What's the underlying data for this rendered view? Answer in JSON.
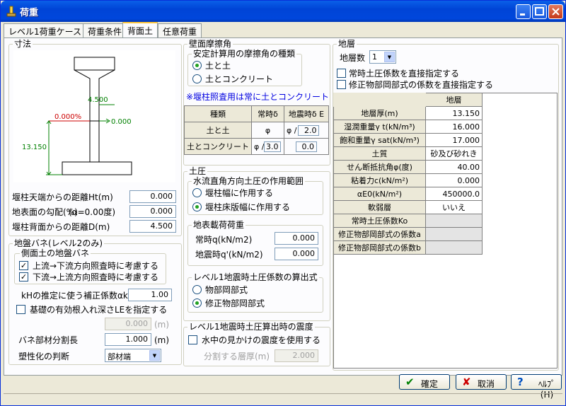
{
  "window": {
    "title": "荷重"
  },
  "tabs": [
    "レベル1荷重ケース",
    "荷重条件",
    "背面土",
    "任意荷重"
  ],
  "dimensions": {
    "group_label": "寸法",
    "diagram": {
      "width_label": "4.500",
      "slope_label": "0.000%",
      "right_label": "0.000",
      "height_label": "13.150"
    },
    "ht_label": "堰柱天端からの距離Ht(m)",
    "ht_value": "0.000",
    "slope_label": "地表面の勾配(%)",
    "alpha_label": "(α=0.00度)",
    "slope_value": "0.000",
    "d_label": "堰柱背面からの距離D(m)",
    "d_value": "4.500"
  },
  "spring": {
    "group_label": "地盤バネ(レベル2のみ)",
    "side_label": "側面土の地盤バネ",
    "cb1": "上流→下流方向照査時に考慮する",
    "cb2": "下流→上流方向照査時に考慮する",
    "kh_label": "kHの推定に使う補正係数αk",
    "kh_value": "1.00",
    "cb3": "基礎の有効根入れ深さLEを指定する",
    "le_value": "0.000",
    "le_unit": "(m)",
    "split_label": "バネ部材分割長",
    "split_value": "1.000",
    "split_unit": "(m)",
    "plastic_label": "塑性化の判断",
    "plastic_value": "部材端"
  },
  "friction": {
    "group_label": "壁面摩擦角",
    "sub_label": "安定計算用の摩擦角の種類",
    "r1": "土と土",
    "r2": "土とコンクリート",
    "note": "※堰柱照査用は常に土とコンクリート",
    "hdr": [
      "種類",
      "常時δ",
      "地震時δ E"
    ],
    "row1": {
      "name": "土と土",
      "normal": "φ",
      "quake_prefix": "φ /",
      "quake_value": "2.0"
    },
    "row2": {
      "name": "土とコンクリート",
      "normal_prefix": "φ /",
      "normal_value": "3.0",
      "quake_value": "0.0"
    }
  },
  "pressure": {
    "group_label": "土圧",
    "range_label": "水流直角方向土圧の作用範囲",
    "r1": "堰柱幅に作用する",
    "r2": "堰柱床版幅に作用する",
    "surcharge_label": "地表載荷荷重",
    "q_label": "常時q(kN/m2)",
    "q_value": "0.000",
    "qe_label": "地震時q'(kN/m2)",
    "qe_value": "0.000",
    "coef_label": "レベル1地震時土圧係数の算出式",
    "c1": "物部岡部式",
    "c2": "修正物部岡部式"
  },
  "seismic": {
    "group_label": "レベル1地震時土圧算出時の震度",
    "cb": "水中の見かけの震度を使用する",
    "layer_label": "分割する層厚(m)",
    "layer_value": "2.000"
  },
  "strata": {
    "group_label": "地層",
    "count_label": "地層数",
    "count_value": "1",
    "cb1": "常時土圧係数を直接指定する",
    "cb2": "修正物部岡部式の係数を直接指定する",
    "col_header": "地層",
    "rows": [
      {
        "label": "地層厚(m)",
        "value": "13.150"
      },
      {
        "label": "湿潤重量γ t(kN/m³)",
        "value": "16.000"
      },
      {
        "label": "飽和重量γ sat(kN/m³)",
        "value": "17.000"
      },
      {
        "label": "土質",
        "value": "砂及び砂れき"
      },
      {
        "label": "せん断抵抗角φ(度)",
        "value": "40.00"
      },
      {
        "label": "粘着力c(kN/m²)",
        "value": "0.000"
      },
      {
        "label": "αE0(kN/m²)",
        "value": "450000.0"
      },
      {
        "label": "軟弱層",
        "value": "いいえ"
      },
      {
        "label": "常時土圧係数Ko",
        "value": ""
      },
      {
        "label": "修正物部岡部式の係数a",
        "value": ""
      },
      {
        "label": "修正物部岡部式の係数b",
        "value": ""
      }
    ]
  },
  "buttons": {
    "ok": "確定",
    "cancel": "取消",
    "help": "ﾍﾙﾌﾟ(H)"
  }
}
